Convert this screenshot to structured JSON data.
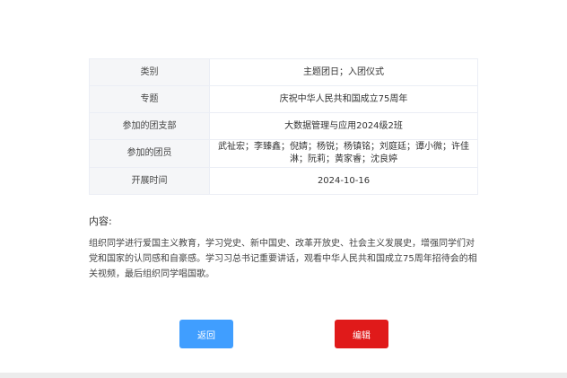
{
  "details": {
    "rows": [
      {
        "label": "类别",
        "value": "主题团日；入团仪式"
      },
      {
        "label": "专题",
        "value": "庆祝中华人民共和国成立75周年"
      },
      {
        "label": "参加的团支部",
        "value": "大数据管理与应用2024级2班"
      },
      {
        "label": "参加的团员",
        "value": "武祉宏；李臻鑫；倪婧；杨锐；杨镇铭；刘庭廷；谭小微；许佳淋；阮莉；黄家睿；沈良婷"
      },
      {
        "label": "开展时间",
        "value": "2024-10-16"
      }
    ]
  },
  "content": {
    "title": "内容:",
    "body": "组织同学进行爱国主义教育，学习党史、新中国史、改革开放史、社会主义发展史，增强同学们对党和国家的认同感和自豪感。学习习总书记重要讲话，观看中华人民共和国成立75周年招待会的相关视频，最后组织同学唱国歌。"
  },
  "actions": {
    "back_label": "返回",
    "edit_label": "编辑"
  },
  "colors": {
    "back_button": "#409eff",
    "edit_button": "#e01a1a",
    "label_cell_bg": "#f5f6f8"
  }
}
